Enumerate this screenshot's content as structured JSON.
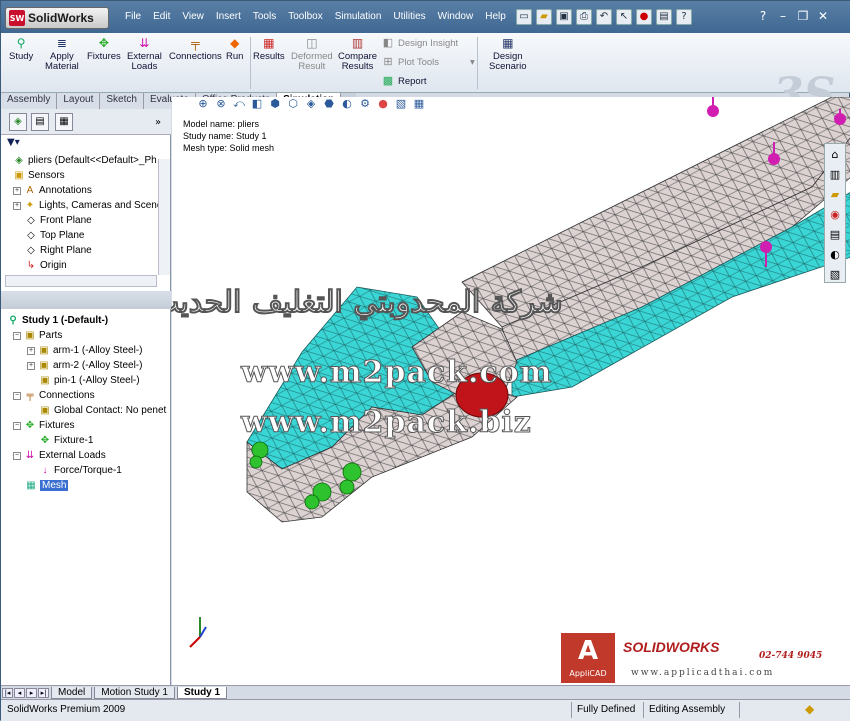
{
  "app": {
    "title": "SolidWorks"
  },
  "menu": [
    "File",
    "Edit",
    "View",
    "Insert",
    "Tools",
    "Toolbox",
    "Simulation",
    "Utilities",
    "Window",
    "Help"
  ],
  "quick_access": [
    "new-icon",
    "open-icon",
    "save-icon",
    "print-icon",
    "undo-icon",
    "select-icon",
    "rebuild-icon",
    "options-icon",
    "help-icon"
  ],
  "window": {
    "help": "?",
    "minimize": "–",
    "restore": "❐",
    "close": "✕"
  },
  "command": {
    "study": "Study",
    "apply_material": [
      "Apply",
      "Material"
    ],
    "fixtures": "Fixtures",
    "external_loads": [
      "External",
      "Loads"
    ],
    "connections": "Connections",
    "run": "Run",
    "results": "Results",
    "deformed_result": [
      "Deformed",
      "Result"
    ],
    "compare_results": [
      "Compare",
      "Results"
    ],
    "design_insight": "Design Insight",
    "plot_tools": "Plot Tools",
    "report": "Report",
    "design_scenario": [
      "Design",
      "Scenario"
    ]
  },
  "tabs": [
    "Assembly",
    "Layout",
    "Sketch",
    "Evaluate",
    "Office Products",
    "Simulation"
  ],
  "feature_tree": {
    "root": "pliers  (Default<<Default>_Ph",
    "items": [
      "Sensors",
      "Annotations",
      "Lights, Cameras and Scene",
      "Front Plane",
      "Top Plane",
      "Right Plane",
      "Origin"
    ]
  },
  "study_tree": {
    "root": "Study 1 (-Default-)",
    "parts_label": "Parts",
    "parts": [
      "arm-1 (-Alloy Steel-)",
      "arm-2 (-Alloy Steel-)",
      "pin-1 (-Alloy Steel-)"
    ],
    "connections_label": "Connections",
    "connections": [
      "Global Contact: No penet"
    ],
    "fixtures_label": "Fixtures",
    "fixtures": [
      "Fixture-1"
    ],
    "loads_label": "External Loads",
    "loads": [
      "Force/Torque-1"
    ],
    "mesh": "Mesh"
  },
  "model_info": {
    "model_name": "Model name: pliers",
    "study_name": "Study name: Study 1",
    "mesh_type": "Mesh type: Solid mesh"
  },
  "watermark": {
    "arabic": "شركة المحدوبتي التغليف الحديث",
    "url1": "www.m2pack.com",
    "url2": "www.m2pack.biz"
  },
  "branding": {
    "applicad": "AppliCAD",
    "solidworks": "SOLIDWORKS",
    "phone": "02-744 9045",
    "web": "www.applicadthai.com"
  },
  "bottom_tabs": [
    "Model",
    "Motion Study 1",
    "Study 1"
  ],
  "status": {
    "product": "SolidWorks Premium 2009",
    "state": "Fully Defined",
    "mode": "Editing Assembly"
  },
  "colors": {
    "mesh_gray": "#d9cfcf",
    "mesh_cyan": "#38d8d8",
    "pin_red": "#c0141a",
    "fixture_green": "#2ec22e",
    "load_magenta": "#d01fb0"
  }
}
